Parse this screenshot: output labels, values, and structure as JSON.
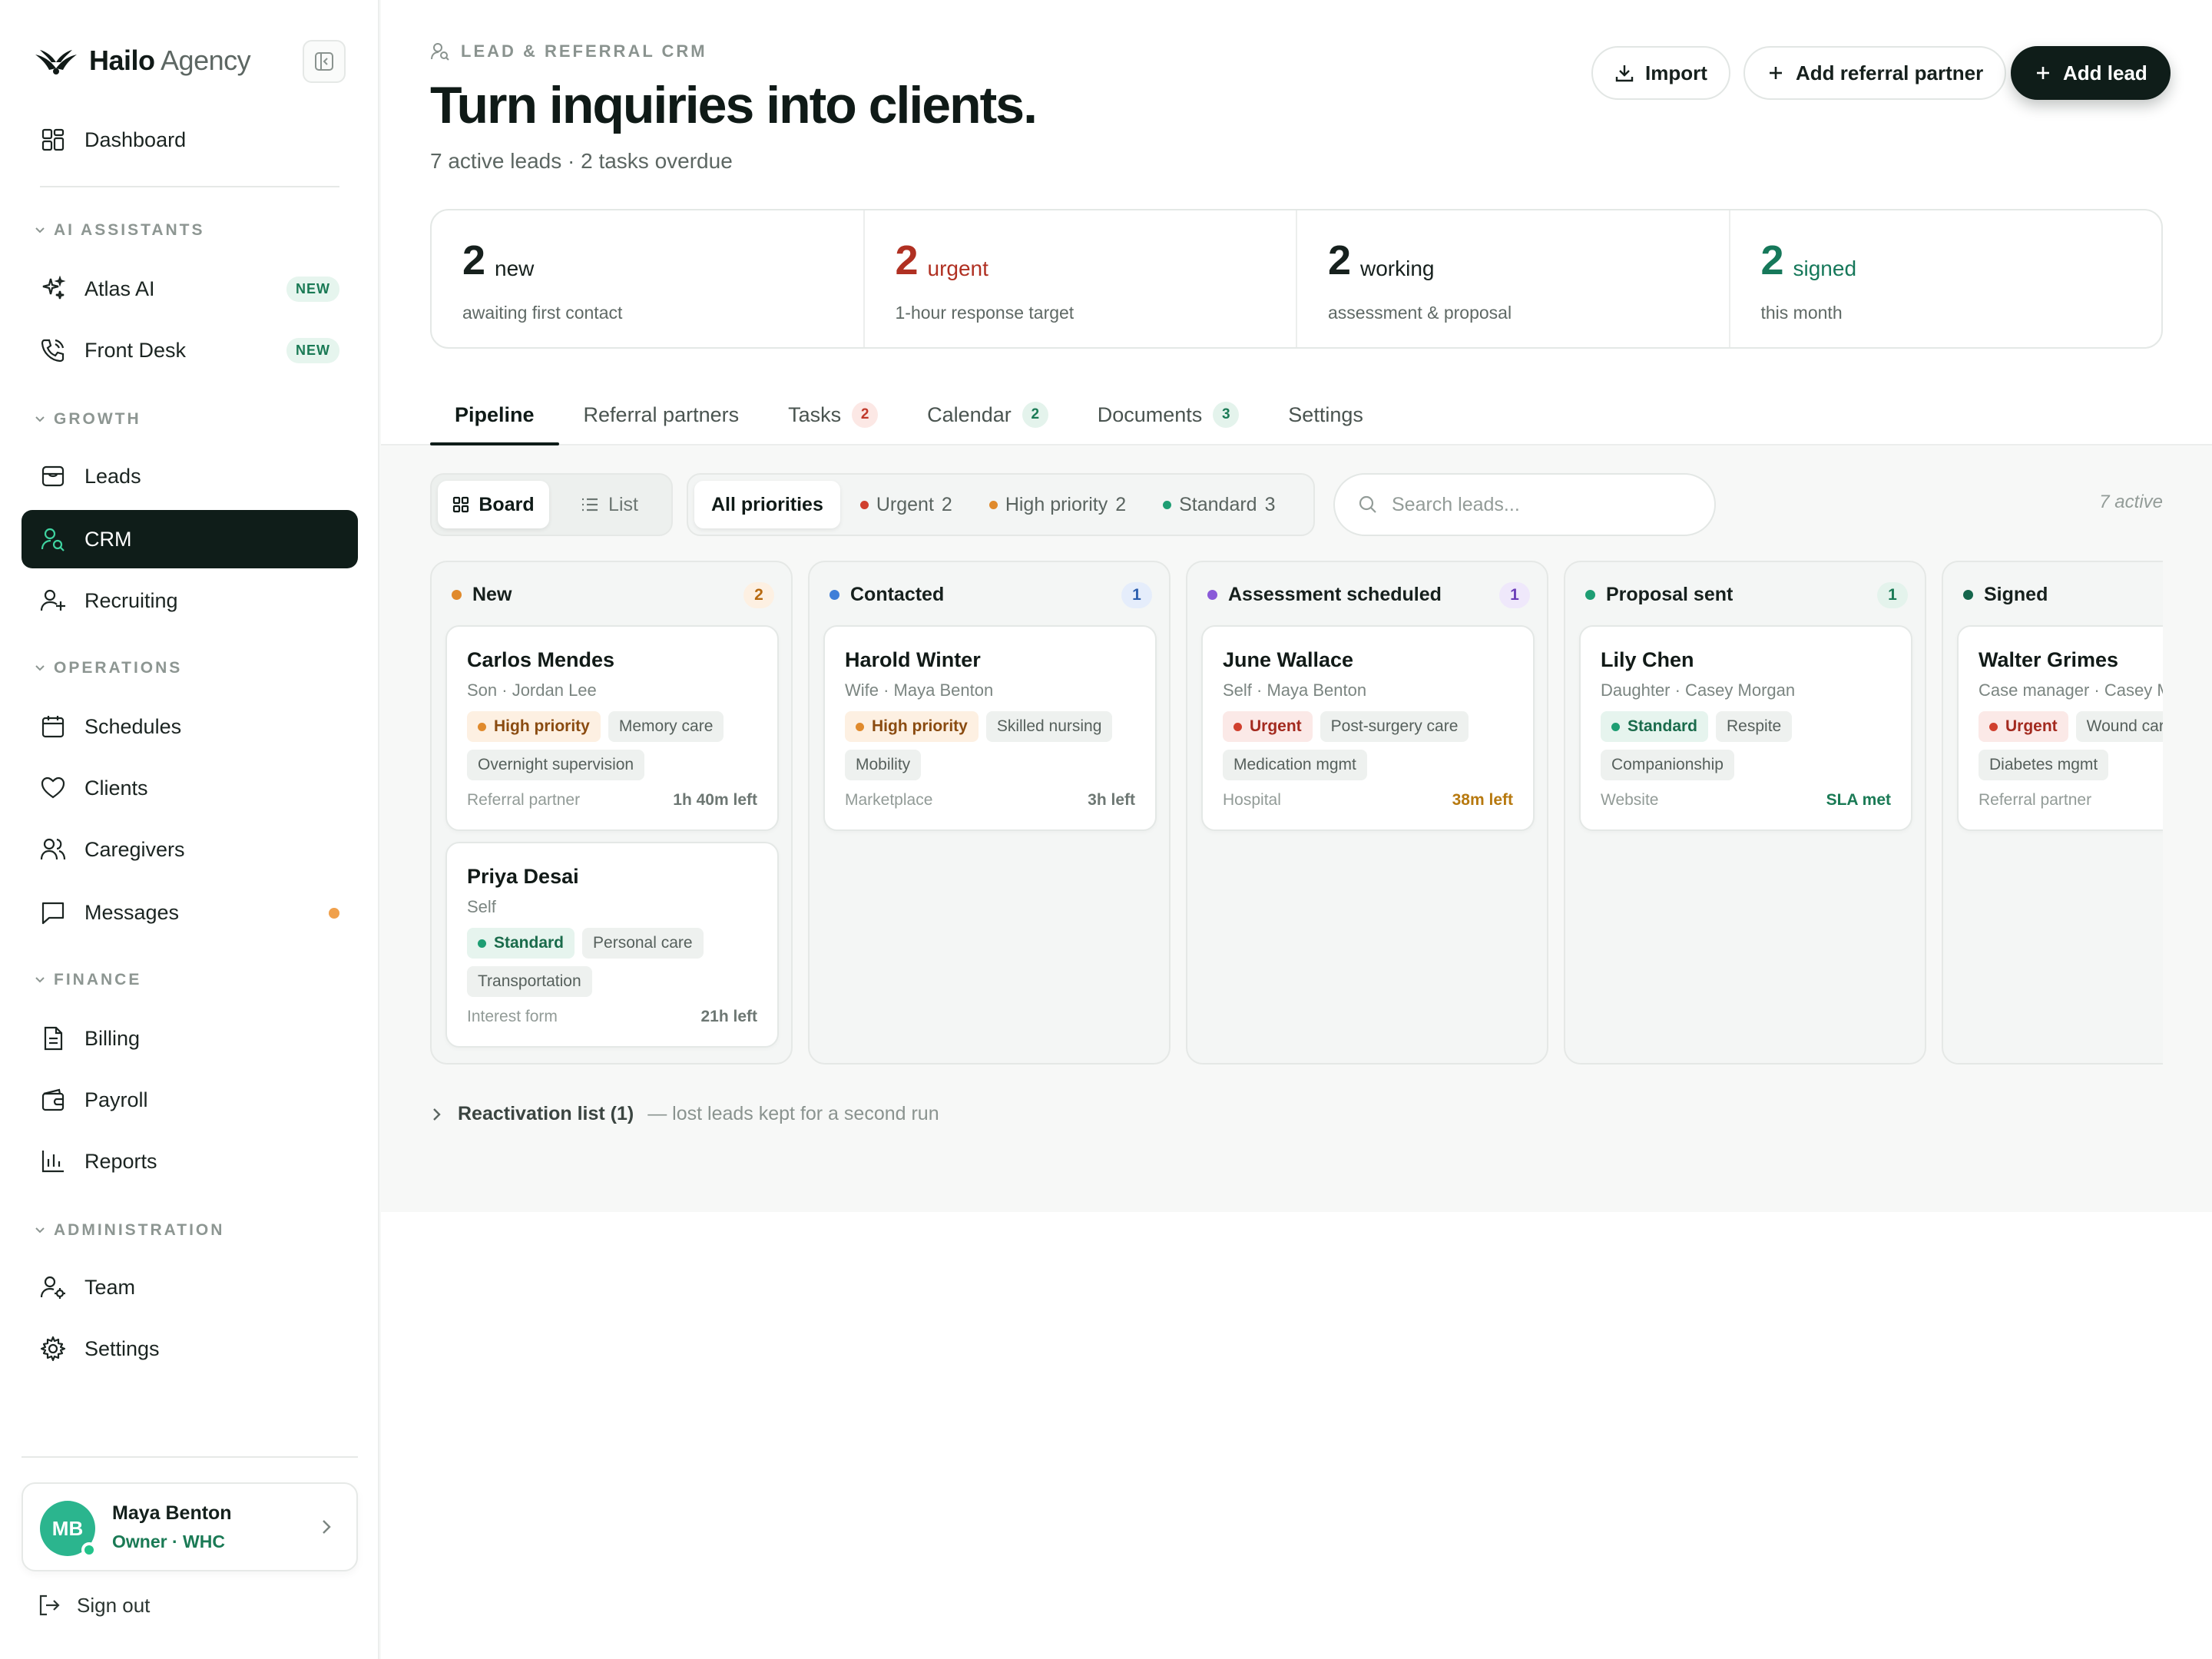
{
  "app": {
    "brand_bold": "Hailo",
    "brand_light": "Agency"
  },
  "sidebar": {
    "dashboard": "Dashboard",
    "sections": {
      "ai": "AI ASSISTANTS",
      "growth": "GROWTH",
      "operations": "OPERATIONS",
      "finance": "FINANCE",
      "administration": "ADMINISTRATION"
    },
    "items": {
      "atlas": "Atlas AI",
      "atlas_badge": "NEW",
      "frontdesk": "Front Desk",
      "frontdesk_badge": "NEW",
      "leads": "Leads",
      "crm": "CRM",
      "recruiting": "Recruiting",
      "schedules": "Schedules",
      "clients": "Clients",
      "caregivers": "Caregivers",
      "messages": "Messages",
      "billing": "Billing",
      "payroll": "Payroll",
      "reports": "Reports",
      "team": "Team",
      "settings": "Settings"
    },
    "user": {
      "initials": "MB",
      "name": "Maya Benton",
      "role": "Owner · WHC"
    },
    "signout": "Sign out",
    "active_item": "CRM"
  },
  "header": {
    "eyebrow": "LEAD & REFERRAL CRM",
    "title": "Turn inquiries into clients.",
    "subtitle": "7 active leads · 2 tasks overdue",
    "import": "Import",
    "add_partner": "Add referral partner",
    "add_lead": "Add lead"
  },
  "stats": [
    {
      "num": "2",
      "word": "new",
      "desc": "awaiting first contact",
      "color": "#16201d"
    },
    {
      "num": "2",
      "word": "urgent",
      "desc": "1-hour response target",
      "color": "#b03022"
    },
    {
      "num": "2",
      "word": "working",
      "desc": "assessment & proposal",
      "color": "#16201d"
    },
    {
      "num": "2",
      "word": "signed",
      "desc": "this month",
      "color": "#16785a"
    }
  ],
  "tabs": {
    "pipeline": "Pipeline",
    "partners": "Referral partners",
    "tasks": "Tasks",
    "tasks_count": "2",
    "calendar": "Calendar",
    "calendar_count": "2",
    "documents": "Documents",
    "documents_count": "3",
    "settings": "Settings"
  },
  "toolbar": {
    "board": "Board",
    "list": "List",
    "all_priorities": "All priorities",
    "urgent": "Urgent",
    "urgent_count": "2",
    "high": "High priority",
    "high_count": "2",
    "standard": "Standard",
    "standard_count": "3",
    "search_placeholder": "Search leads...",
    "active_count": "7 active"
  },
  "colors": {
    "urgent": "#d0402e",
    "high": "#e08a2c",
    "standard": "#1e9e73",
    "new": "#e08a2c",
    "contacted": "#3f7fd8",
    "assessment": "#8a5ad8",
    "proposal": "#1e9e73",
    "signed": "#15664c"
  },
  "board": {
    "columns": [
      {
        "title": "New",
        "count": "2",
        "cards": [
          {
            "name": "Carlos Mendes",
            "rel": "Son · Jordan Lee",
            "priority": "High priority",
            "tags": [
              "Memory care",
              "Overnight supervision"
            ],
            "source": "Referral partner",
            "sla": "1h 40m left"
          },
          {
            "name": "Priya Desai",
            "rel": "Self",
            "priority": "Standard",
            "tags": [
              "Personal care",
              "Transportation"
            ],
            "source": "Interest form",
            "sla": "21h left"
          }
        ]
      },
      {
        "title": "Contacted",
        "count": "1",
        "cards": [
          {
            "name": "Harold Winter",
            "rel": "Wife · Maya Benton",
            "priority": "High priority",
            "tags": [
              "Skilled nursing",
              "Mobility"
            ],
            "source": "Marketplace",
            "sla": "3h left"
          }
        ]
      },
      {
        "title": "Assessment scheduled",
        "count": "1",
        "cards": [
          {
            "name": "June Wallace",
            "rel": "Self · Maya Benton",
            "priority": "Urgent",
            "tags": [
              "Post-surgery care",
              "Medication mgmt"
            ],
            "source": "Hospital",
            "sla": "38m left"
          }
        ]
      },
      {
        "title": "Proposal sent",
        "count": "1",
        "cards": [
          {
            "name": "Lily Chen",
            "rel": "Daughter · Casey Morgan",
            "priority": "Standard",
            "tags": [
              "Respite",
              "Companionship"
            ],
            "source": "Website",
            "sla": "SLA met"
          }
        ]
      },
      {
        "title": "Signed",
        "count": "",
        "cards": [
          {
            "name": "Walter Grimes",
            "rel": "Case manager · Casey M",
            "priority": "Urgent",
            "tags": [
              "Wound care",
              "Diabetes mgmt"
            ],
            "source": "Referral partner",
            "sla": ""
          }
        ]
      }
    ]
  },
  "reactivation": {
    "label": "Reactivation list (1)",
    "note": "— lost leads kept for a second run"
  }
}
